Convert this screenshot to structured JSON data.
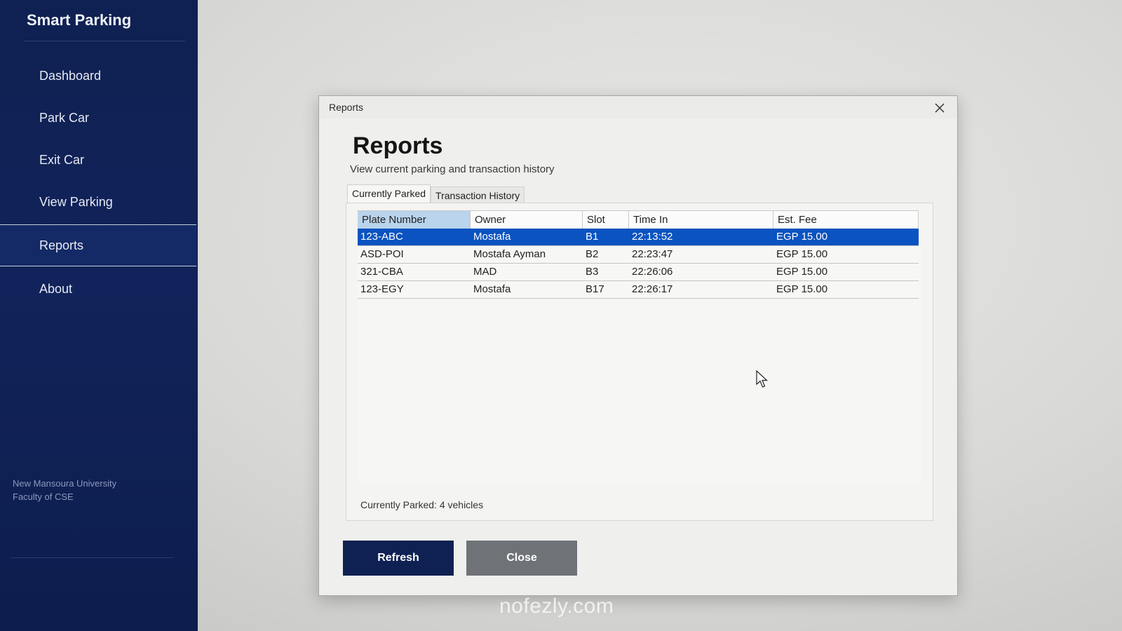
{
  "sidebar": {
    "brand": "Smart Parking",
    "items": [
      {
        "label": "Dashboard"
      },
      {
        "label": "Park Car"
      },
      {
        "label": "Exit Car"
      },
      {
        "label": "View Parking"
      },
      {
        "label": "Reports",
        "active": true
      },
      {
        "label": "About"
      }
    ],
    "footer_line1": "New Mansoura University",
    "footer_line2": "Faculty of CSE"
  },
  "dialog": {
    "window_title": "Reports",
    "heading": "Reports",
    "subheading": "View current parking and transaction history",
    "tabs": [
      {
        "label": "Currently Parked",
        "active": true
      },
      {
        "label": "Transaction History",
        "active": false
      }
    ],
    "table": {
      "columns": [
        "Plate Number",
        "Owner",
        "Slot",
        "Time In",
        "Est. Fee"
      ],
      "rows": [
        [
          "123-ABC",
          "Mostafa",
          "B1",
          "22:13:52",
          "EGP 15.00"
        ],
        [
          "ASD-POI",
          "Mostafa Ayman",
          "B2",
          "22:23:47",
          "EGP 15.00"
        ],
        [
          "321-CBA",
          "MAD",
          "B3",
          "22:26:06",
          "EGP 15.00"
        ],
        [
          "123-EGY",
          "Mostafa",
          "B17",
          "22:26:17",
          "EGP 15.00"
        ]
      ],
      "selected_row": 0
    },
    "status": "Currently Parked: 4 vehicles",
    "buttons": {
      "refresh": "Refresh",
      "close": "Close"
    }
  },
  "watermark": "nofezly.com",
  "colors": {
    "sidebar_bg": "#0f2152",
    "selected_row": "#0a53c0",
    "refresh_button": "#0f2152",
    "close_button": "#6f7378"
  },
  "icons": {
    "close": "close-icon",
    "cursor": "mouse-pointer-icon"
  }
}
